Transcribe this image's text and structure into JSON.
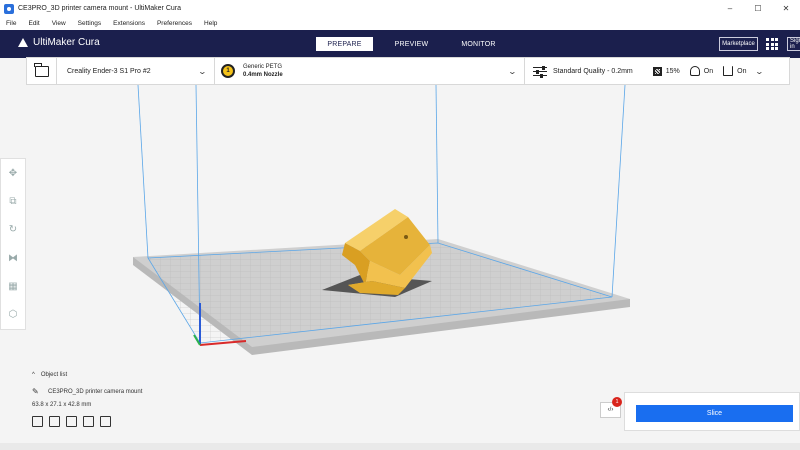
{
  "window": {
    "title": "CE3PRO_3D printer camera mount - UltiMaker Cura",
    "controls": [
      "–",
      "☐",
      "✕"
    ]
  },
  "menu": [
    "File",
    "Edit",
    "View",
    "Settings",
    "Extensions",
    "Preferences",
    "Help"
  ],
  "header": {
    "brand": "UltiMaker Cura",
    "tabs": [
      {
        "label": "PREPARE",
        "active": true
      },
      {
        "label": "PREVIEW",
        "active": false
      },
      {
        "label": "MONITOR",
        "active": false
      }
    ],
    "marketplace": "Marketplace",
    "signin": "Sign in"
  },
  "toolbar": {
    "printer": "Creality Ender-3 S1 Pro #2",
    "extruder_number": "1",
    "material": "Generic PETG",
    "nozzle": "0.4mm Nozzle",
    "quality": "Standard Quality - 0.2mm",
    "infill": "15%",
    "support": "On",
    "adhesion": "On"
  },
  "object_list": {
    "header": "Object list",
    "item": "CE3PRO_3D printer camera mount",
    "dimensions": "63.8 x 27.1 x 42.8 mm"
  },
  "slice": {
    "label": "Slice",
    "extensions_badge": "1"
  },
  "colors": {
    "header_bg": "#1b1f4d",
    "slice_button": "#196ef0",
    "model": "#f2c14e",
    "build_plate": "#c9c9c9",
    "badge": "#d9241c"
  }
}
